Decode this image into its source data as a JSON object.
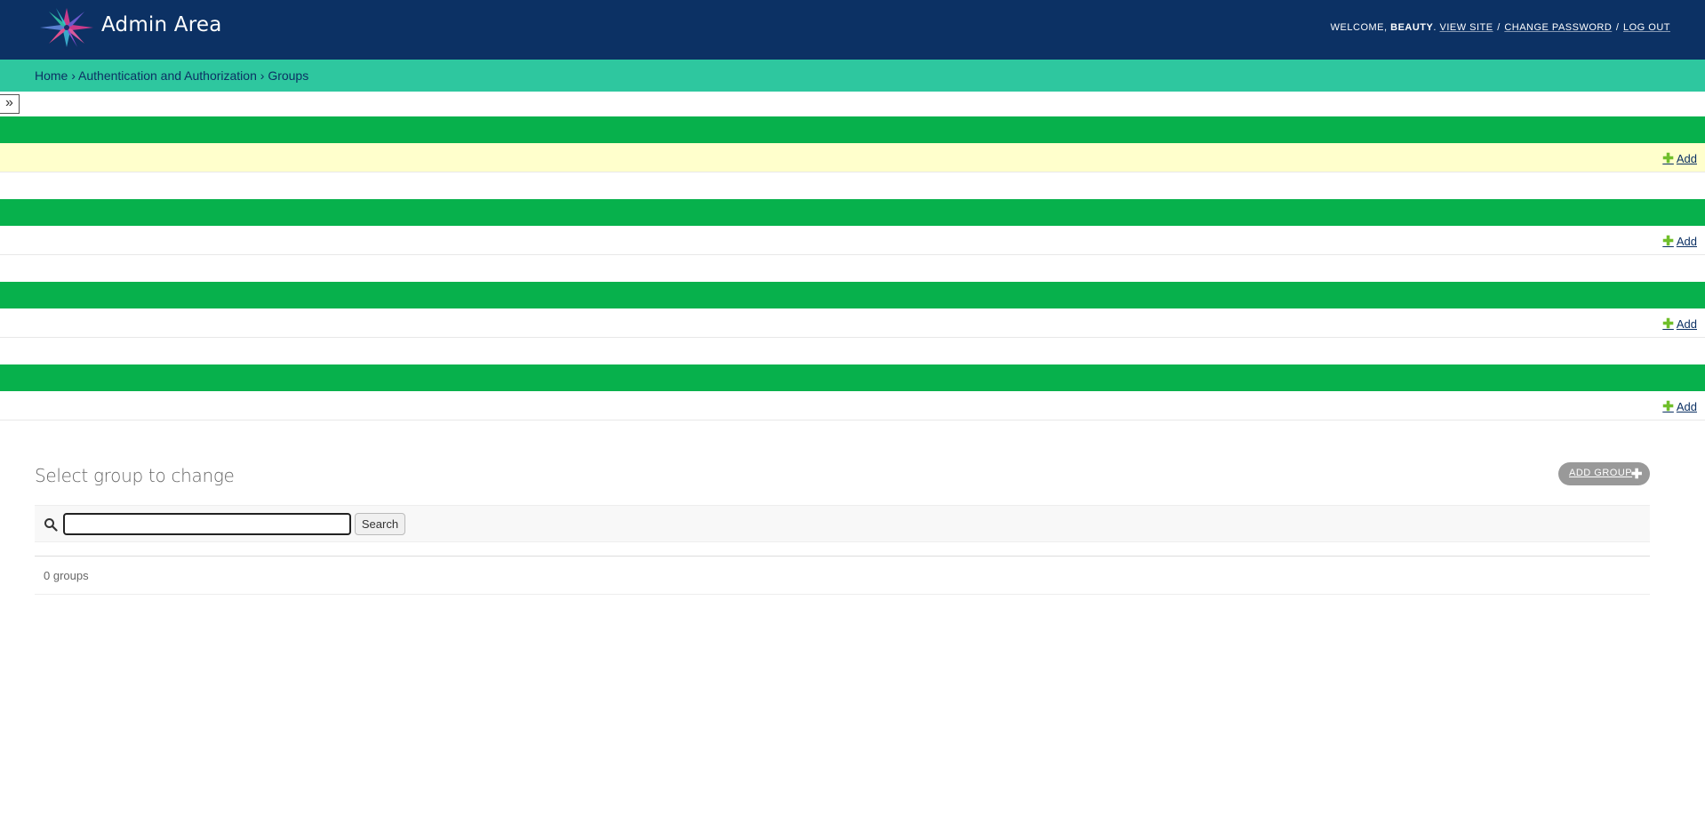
{
  "header": {
    "site_title": "Admin Area",
    "welcome": "WELCOME,",
    "username": "BEAUTY",
    "view_site": "VIEW SITE",
    "change_password": "CHANGE PASSWORD",
    "log_out": "LOG OUT",
    "sep": "/",
    "bg_color": "#0c3164"
  },
  "breadcrumbs": {
    "items": [
      "Home",
      "Authentication and Authorization",
      "Groups"
    ],
    "separator": "›",
    "bg_color": "#2ec79f"
  },
  "nav_toggle": {
    "glyph": "»"
  },
  "app_rows": [
    {
      "add_label": "Add"
    },
    {
      "add_label": "Add"
    },
    {
      "add_label": "Add"
    },
    {
      "add_label": "Add"
    }
  ],
  "colors": {
    "caption_green": "#07b14c",
    "highlight_yellow": "#ffffcc",
    "add_plus": "#70bf2b"
  },
  "content": {
    "title": "Select group to change",
    "add_button_label": "ADD GROUP",
    "search_button_label": "Search",
    "search_value": "",
    "result_count": "0 groups"
  }
}
